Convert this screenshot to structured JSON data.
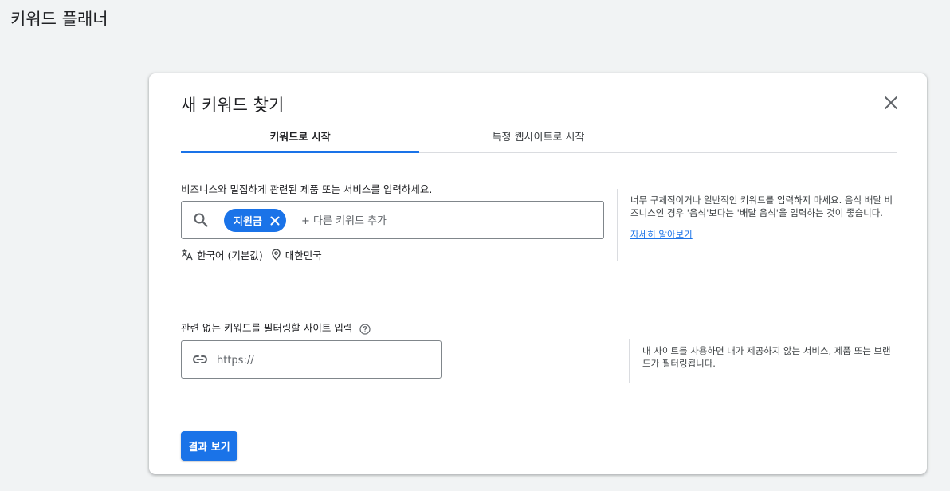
{
  "page": {
    "title": "키워드 플래너"
  },
  "dialog": {
    "title": "새 키워드 찾기",
    "close_icon": "close-icon",
    "tabs": [
      {
        "label": "키워드로 시작",
        "active": true
      },
      {
        "label": "특정 웹사이트로 시작",
        "active": false
      }
    ],
    "keyword_section": {
      "label": "비즈니스와 밀접하게 관련된 제품 또는 서비스를 입력하세요.",
      "chip": "지원금",
      "placeholder": "+ 다른 키워드 추가",
      "language": "한국어 (기본값)",
      "location": "대한민국",
      "note": "너무 구체적이거나 일반적인 키워드를 입력하지 마세요. 음식 배달 비즈니스인 경우 '음식'보다는 '배달 음식'을 입력하는 것이 좋습니다.",
      "learn_more": "자세히 알아보기"
    },
    "site_filter": {
      "label": "관련 없는 키워드를 필터링할 사이트 입력",
      "placeholder": "https://",
      "note": "내 사이트를 사용하면 내가 제공하지 않는 서비스, 제품 또는 브랜드가 필터링됩니다."
    },
    "submit_label": "결과 보기"
  },
  "colors": {
    "accent": "#1a73e8",
    "background": "#f1f3f4",
    "text": "#202124"
  }
}
